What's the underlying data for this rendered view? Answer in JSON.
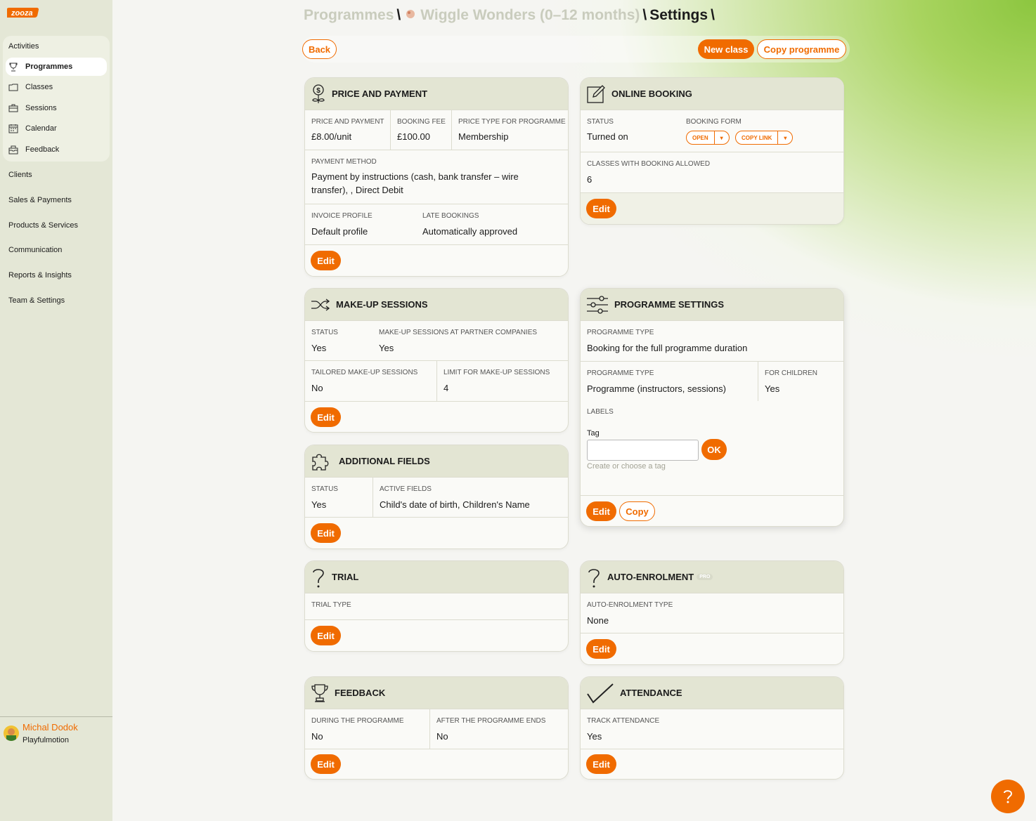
{
  "app": {
    "brand": "zooza",
    "accent": "#f06b00"
  },
  "sidebar": {
    "activities": "Activities",
    "sub": [
      {
        "label": "Programmes",
        "icon": "trophy-icon",
        "active": true
      },
      {
        "label": "Classes",
        "icon": "folder-icon"
      },
      {
        "label": "Sessions",
        "icon": "briefcase-icon"
      },
      {
        "label": "Calendar",
        "icon": "calendar-icon"
      },
      {
        "label": "Feedback",
        "icon": "inbox-icon"
      }
    ],
    "items": [
      "Clients",
      "Sales & Payments",
      "Products & Services",
      "Communication",
      "Reports & Insights",
      "Team & Settings"
    ],
    "user": {
      "name": "Michal Dodok",
      "org": "Playfulmotion"
    }
  },
  "breadcrumb": {
    "root": "Programmes",
    "programme": "Wiggle Wonders (0–12 months)",
    "current": "Settings",
    "sep": "\\"
  },
  "toolbar": {
    "back": "Back",
    "new_class": "New class",
    "copy_programme": "Copy programme"
  },
  "cards": {
    "price": {
      "title": "PRICE AND PAYMENT",
      "price_label": "PRICE AND PAYMENT",
      "price_value": "£8.00/unit",
      "fee_label": "BOOKING FEE",
      "fee_value": "£100.00",
      "type_label": "PRICE TYPE FOR PROGRAMME",
      "type_value": "Membership",
      "method_label": "PAYMENT METHOD",
      "method_value": "Payment by instructions (cash, bank transfer – wire transfer), , Direct Debit",
      "invoice_label": "INVOICE PROFILE",
      "invoice_value": "Default profile",
      "late_label": "LATE BOOKINGS",
      "late_value": "Automatically approved",
      "edit": "Edit"
    },
    "online": {
      "title": "ONLINE BOOKING",
      "status_label": "STATUS",
      "status_value": "Turned on",
      "form_label": "BOOKING FORM",
      "open": "OPEN",
      "copy_link": "COPY LINK",
      "classes_label": "CLASSES WITH BOOKING ALLOWED",
      "classes_value": "6",
      "edit": "Edit"
    },
    "makeup": {
      "title": "MAKE-UP SESSIONS",
      "status_label": "STATUS",
      "status_value": "Yes",
      "partner_label": "MAKE-UP SESSIONS AT PARTNER COMPANIES",
      "partner_value": "Yes",
      "tailored_label": "TAILORED MAKE-UP SESSIONS",
      "tailored_value": "No",
      "limit_label": "LIMIT FOR MAKE-UP SESSIONS",
      "limit_value": "4",
      "edit": "Edit"
    },
    "progset": {
      "title": "PROGRAMME SETTINGS",
      "type_label": "PROGRAMME TYPE",
      "type_value": "Booking for the full programme duration",
      "type2_label": "PROGRAMME TYPE",
      "type2_value": "Programme (instructors, sessions)",
      "children_label": "FOR CHILDREN",
      "children_value": "Yes",
      "labels_label": "LABELS",
      "tag_label": "Tag",
      "ok": "OK",
      "hint": "Create or choose a tag",
      "edit": "Edit",
      "copy": "Copy"
    },
    "fields": {
      "title": "ADDITIONAL FIELDS",
      "status_label": "STATUS",
      "status_value": "Yes",
      "active_label": "ACTIVE FIELDS",
      "active_value": "Child's date of birth, Children's Name",
      "edit": "Edit"
    },
    "trial": {
      "title": "TRIAL",
      "type_label": "TRIAL TYPE",
      "edit": "Edit"
    },
    "auto": {
      "title": "AUTO-ENROLMENT",
      "pro": "PRO",
      "type_label": "AUTO-ENROLMENT TYPE",
      "type_value": "None",
      "edit": "Edit"
    },
    "feedback": {
      "title": "FEEDBACK",
      "during_label": "DURING THE PROGRAMME",
      "during_value": "No",
      "after_label": "AFTER THE PROGRAMME ENDS",
      "after_value": "No",
      "edit": "Edit"
    },
    "attendance": {
      "title": "ATTENDANCE",
      "track_label": "TRACK ATTENDANCE",
      "track_value": "Yes",
      "edit": "Edit"
    }
  }
}
